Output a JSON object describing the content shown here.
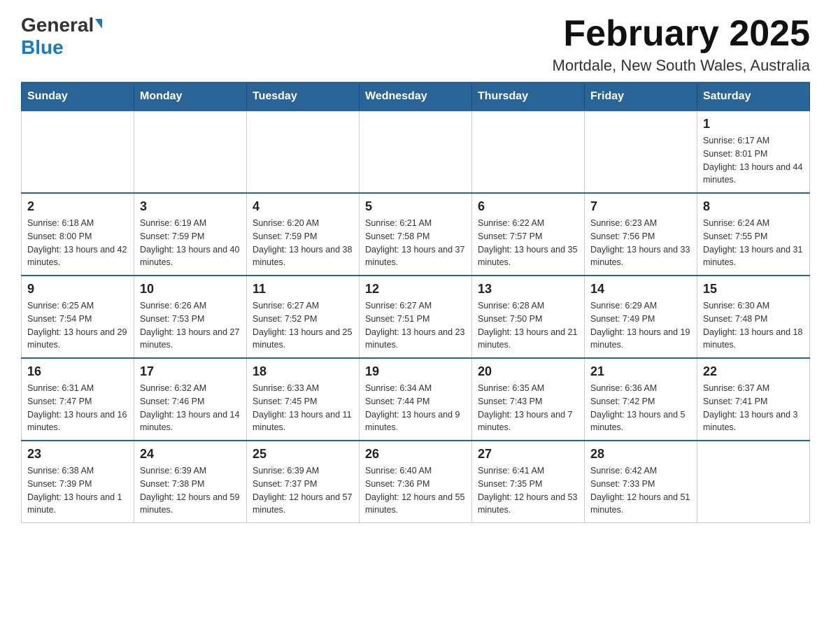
{
  "header": {
    "logo_general": "General",
    "logo_blue": "Blue",
    "title": "February 2025",
    "subtitle": "Mortdale, New South Wales, Australia"
  },
  "weekdays": [
    "Sunday",
    "Monday",
    "Tuesday",
    "Wednesday",
    "Thursday",
    "Friday",
    "Saturday"
  ],
  "weeks": [
    [
      {
        "day": "",
        "info": ""
      },
      {
        "day": "",
        "info": ""
      },
      {
        "day": "",
        "info": ""
      },
      {
        "day": "",
        "info": ""
      },
      {
        "day": "",
        "info": ""
      },
      {
        "day": "",
        "info": ""
      },
      {
        "day": "1",
        "info": "Sunrise: 6:17 AM\nSunset: 8:01 PM\nDaylight: 13 hours and 44 minutes."
      }
    ],
    [
      {
        "day": "2",
        "info": "Sunrise: 6:18 AM\nSunset: 8:00 PM\nDaylight: 13 hours and 42 minutes."
      },
      {
        "day": "3",
        "info": "Sunrise: 6:19 AM\nSunset: 7:59 PM\nDaylight: 13 hours and 40 minutes."
      },
      {
        "day": "4",
        "info": "Sunrise: 6:20 AM\nSunset: 7:59 PM\nDaylight: 13 hours and 38 minutes."
      },
      {
        "day": "5",
        "info": "Sunrise: 6:21 AM\nSunset: 7:58 PM\nDaylight: 13 hours and 37 minutes."
      },
      {
        "day": "6",
        "info": "Sunrise: 6:22 AM\nSunset: 7:57 PM\nDaylight: 13 hours and 35 minutes."
      },
      {
        "day": "7",
        "info": "Sunrise: 6:23 AM\nSunset: 7:56 PM\nDaylight: 13 hours and 33 minutes."
      },
      {
        "day": "8",
        "info": "Sunrise: 6:24 AM\nSunset: 7:55 PM\nDaylight: 13 hours and 31 minutes."
      }
    ],
    [
      {
        "day": "9",
        "info": "Sunrise: 6:25 AM\nSunset: 7:54 PM\nDaylight: 13 hours and 29 minutes."
      },
      {
        "day": "10",
        "info": "Sunrise: 6:26 AM\nSunset: 7:53 PM\nDaylight: 13 hours and 27 minutes."
      },
      {
        "day": "11",
        "info": "Sunrise: 6:27 AM\nSunset: 7:52 PM\nDaylight: 13 hours and 25 minutes."
      },
      {
        "day": "12",
        "info": "Sunrise: 6:27 AM\nSunset: 7:51 PM\nDaylight: 13 hours and 23 minutes."
      },
      {
        "day": "13",
        "info": "Sunrise: 6:28 AM\nSunset: 7:50 PM\nDaylight: 13 hours and 21 minutes."
      },
      {
        "day": "14",
        "info": "Sunrise: 6:29 AM\nSunset: 7:49 PM\nDaylight: 13 hours and 19 minutes."
      },
      {
        "day": "15",
        "info": "Sunrise: 6:30 AM\nSunset: 7:48 PM\nDaylight: 13 hours and 18 minutes."
      }
    ],
    [
      {
        "day": "16",
        "info": "Sunrise: 6:31 AM\nSunset: 7:47 PM\nDaylight: 13 hours and 16 minutes."
      },
      {
        "day": "17",
        "info": "Sunrise: 6:32 AM\nSunset: 7:46 PM\nDaylight: 13 hours and 14 minutes."
      },
      {
        "day": "18",
        "info": "Sunrise: 6:33 AM\nSunset: 7:45 PM\nDaylight: 13 hours and 11 minutes."
      },
      {
        "day": "19",
        "info": "Sunrise: 6:34 AM\nSunset: 7:44 PM\nDaylight: 13 hours and 9 minutes."
      },
      {
        "day": "20",
        "info": "Sunrise: 6:35 AM\nSunset: 7:43 PM\nDaylight: 13 hours and 7 minutes."
      },
      {
        "day": "21",
        "info": "Sunrise: 6:36 AM\nSunset: 7:42 PM\nDaylight: 13 hours and 5 minutes."
      },
      {
        "day": "22",
        "info": "Sunrise: 6:37 AM\nSunset: 7:41 PM\nDaylight: 13 hours and 3 minutes."
      }
    ],
    [
      {
        "day": "23",
        "info": "Sunrise: 6:38 AM\nSunset: 7:39 PM\nDaylight: 13 hours and 1 minute."
      },
      {
        "day": "24",
        "info": "Sunrise: 6:39 AM\nSunset: 7:38 PM\nDaylight: 12 hours and 59 minutes."
      },
      {
        "day": "25",
        "info": "Sunrise: 6:39 AM\nSunset: 7:37 PM\nDaylight: 12 hours and 57 minutes."
      },
      {
        "day": "26",
        "info": "Sunrise: 6:40 AM\nSunset: 7:36 PM\nDaylight: 12 hours and 55 minutes."
      },
      {
        "day": "27",
        "info": "Sunrise: 6:41 AM\nSunset: 7:35 PM\nDaylight: 12 hours and 53 minutes."
      },
      {
        "day": "28",
        "info": "Sunrise: 6:42 AM\nSunset: 7:33 PM\nDaylight: 12 hours and 51 minutes."
      },
      {
        "day": "",
        "info": ""
      }
    ]
  ]
}
